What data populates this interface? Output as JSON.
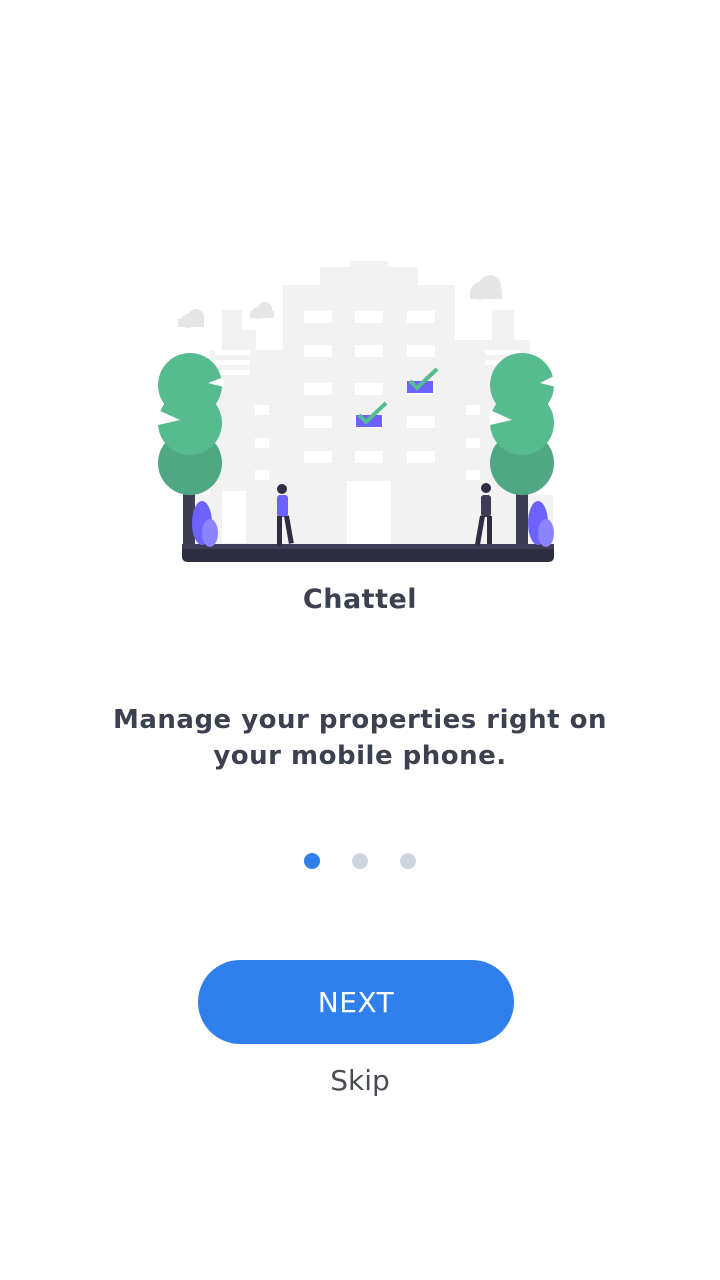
{
  "onboarding": {
    "illustration_icon": "city-buildings-illustration",
    "title": "Chattel",
    "description": "Manage your properties right on your mobile phone.",
    "page_indicator": {
      "total_pages": 3,
      "current_page": 1
    },
    "next_label": "NEXT",
    "skip_label": "Skip"
  },
  "colors": {
    "accent": "#2F80ED",
    "text_primary": "#3C4150",
    "dot_inactive": "#CFD5DC",
    "illustration_green": "#57BB90",
    "illustration_purple": "#6C63FF"
  }
}
